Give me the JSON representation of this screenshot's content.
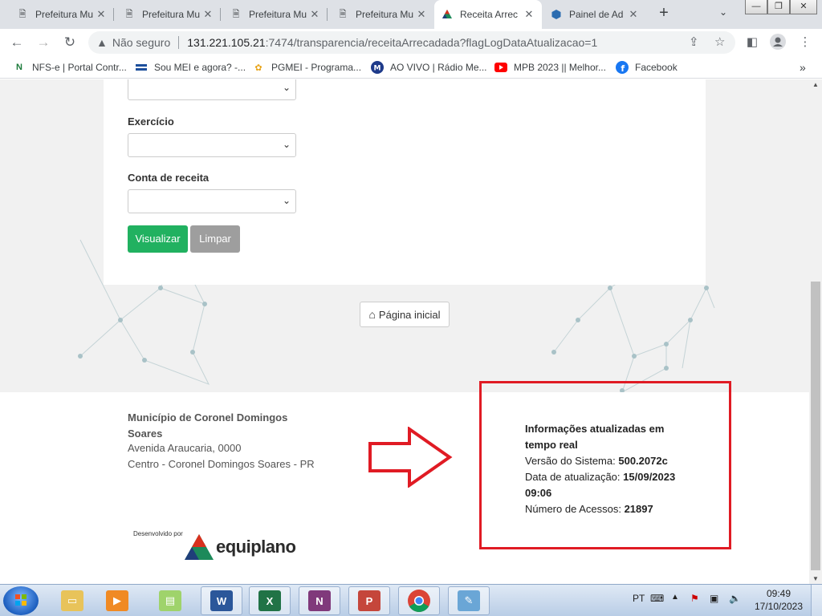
{
  "browser": {
    "tabs": [
      {
        "title": "Prefeitura Mu",
        "active": false
      },
      {
        "title": "Prefeitura Mu",
        "active": false
      },
      {
        "title": "Prefeitura Mu",
        "active": false
      },
      {
        "title": "Prefeitura Mu",
        "active": false
      },
      {
        "title": "Receita Arrec",
        "active": true
      },
      {
        "title": "Painel de Ad",
        "active": false
      }
    ],
    "new_tab_label": "+",
    "address": {
      "security_label": "Não seguro",
      "host": "131.221.105.21",
      "path": ":7474/transparencia/receitaArrecadada?flagLogDataAtualizacao=1"
    },
    "bookmarks": [
      {
        "label": "NFS-e | Portal Contr...",
        "icon": "nfse-icon"
      },
      {
        "label": "Sou MEI e agora? -...",
        "icon": "mei-icon"
      },
      {
        "label": "PGMEI - Programa...",
        "icon": "pgmei-icon"
      },
      {
        "label": "AO VIVO | Rádio Me...",
        "icon": "radio-icon"
      },
      {
        "label": "MPB 2023 || Melhor...",
        "icon": "youtube-icon"
      },
      {
        "label": "Facebook",
        "icon": "facebook-icon"
      }
    ],
    "more_bookmarks": "»"
  },
  "form": {
    "fields": [
      {
        "label": "Exercício"
      },
      {
        "label": "Conta de receita"
      }
    ],
    "submit_label": "Visualizar",
    "clear_label": "Limpar"
  },
  "home_button": {
    "label": "Página inicial"
  },
  "footer": {
    "municipality": "Município de Coronel Domingos Soares",
    "address_line1": "Avenida Araucaria, 0000",
    "address_line2": "Centro - Coronel Domingos Soares - PR",
    "developed_by": "Desenvolvido por",
    "developer": "equiplano",
    "info": {
      "heading": "Informações atualizadas em tempo real",
      "version_label": "Versão do Sistema:",
      "version_value": "500.2072c",
      "updated_label": "Data de atualização:",
      "updated_value": "15/09/2023 09:06",
      "accesses_label": "Número de Acessos:",
      "accesses_value": "21897"
    }
  },
  "taskbar": {
    "language": "PT",
    "time": "09:49",
    "date": "17/10/2023"
  },
  "colors": {
    "primary_button": "#21b160",
    "secondary_button": "#9e9e9e",
    "highlight_red": "#e01b24"
  }
}
